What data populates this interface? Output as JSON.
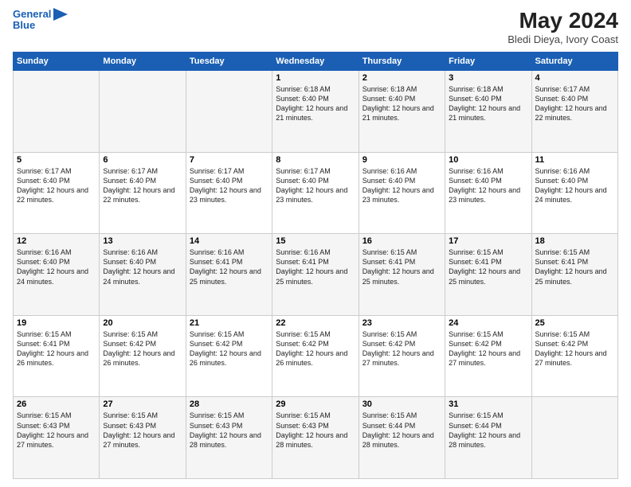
{
  "logo": {
    "line1": "General",
    "line2": "Blue"
  },
  "title": "May 2024",
  "subtitle": "Bledi Dieya, Ivory Coast",
  "days_header": [
    "Sunday",
    "Monday",
    "Tuesday",
    "Wednesday",
    "Thursday",
    "Friday",
    "Saturday"
  ],
  "weeks": [
    [
      {
        "day": "",
        "info": ""
      },
      {
        "day": "",
        "info": ""
      },
      {
        "day": "",
        "info": ""
      },
      {
        "day": "1",
        "info": "Sunrise: 6:18 AM\nSunset: 6:40 PM\nDaylight: 12 hours and 21 minutes."
      },
      {
        "day": "2",
        "info": "Sunrise: 6:18 AM\nSunset: 6:40 PM\nDaylight: 12 hours and 21 minutes."
      },
      {
        "day": "3",
        "info": "Sunrise: 6:18 AM\nSunset: 6:40 PM\nDaylight: 12 hours and 21 minutes."
      },
      {
        "day": "4",
        "info": "Sunrise: 6:17 AM\nSunset: 6:40 PM\nDaylight: 12 hours and 22 minutes."
      }
    ],
    [
      {
        "day": "5",
        "info": "Sunrise: 6:17 AM\nSunset: 6:40 PM\nDaylight: 12 hours and 22 minutes."
      },
      {
        "day": "6",
        "info": "Sunrise: 6:17 AM\nSunset: 6:40 PM\nDaylight: 12 hours and 22 minutes."
      },
      {
        "day": "7",
        "info": "Sunrise: 6:17 AM\nSunset: 6:40 PM\nDaylight: 12 hours and 23 minutes."
      },
      {
        "day": "8",
        "info": "Sunrise: 6:17 AM\nSunset: 6:40 PM\nDaylight: 12 hours and 23 minutes."
      },
      {
        "day": "9",
        "info": "Sunrise: 6:16 AM\nSunset: 6:40 PM\nDaylight: 12 hours and 23 minutes."
      },
      {
        "day": "10",
        "info": "Sunrise: 6:16 AM\nSunset: 6:40 PM\nDaylight: 12 hours and 23 minutes."
      },
      {
        "day": "11",
        "info": "Sunrise: 6:16 AM\nSunset: 6:40 PM\nDaylight: 12 hours and 24 minutes."
      }
    ],
    [
      {
        "day": "12",
        "info": "Sunrise: 6:16 AM\nSunset: 6:40 PM\nDaylight: 12 hours and 24 minutes."
      },
      {
        "day": "13",
        "info": "Sunrise: 6:16 AM\nSunset: 6:40 PM\nDaylight: 12 hours and 24 minutes."
      },
      {
        "day": "14",
        "info": "Sunrise: 6:16 AM\nSunset: 6:41 PM\nDaylight: 12 hours and 25 minutes."
      },
      {
        "day": "15",
        "info": "Sunrise: 6:16 AM\nSunset: 6:41 PM\nDaylight: 12 hours and 25 minutes."
      },
      {
        "day": "16",
        "info": "Sunrise: 6:15 AM\nSunset: 6:41 PM\nDaylight: 12 hours and 25 minutes."
      },
      {
        "day": "17",
        "info": "Sunrise: 6:15 AM\nSunset: 6:41 PM\nDaylight: 12 hours and 25 minutes."
      },
      {
        "day": "18",
        "info": "Sunrise: 6:15 AM\nSunset: 6:41 PM\nDaylight: 12 hours and 25 minutes."
      }
    ],
    [
      {
        "day": "19",
        "info": "Sunrise: 6:15 AM\nSunset: 6:41 PM\nDaylight: 12 hours and 26 minutes."
      },
      {
        "day": "20",
        "info": "Sunrise: 6:15 AM\nSunset: 6:42 PM\nDaylight: 12 hours and 26 minutes."
      },
      {
        "day": "21",
        "info": "Sunrise: 6:15 AM\nSunset: 6:42 PM\nDaylight: 12 hours and 26 minutes."
      },
      {
        "day": "22",
        "info": "Sunrise: 6:15 AM\nSunset: 6:42 PM\nDaylight: 12 hours and 26 minutes."
      },
      {
        "day": "23",
        "info": "Sunrise: 6:15 AM\nSunset: 6:42 PM\nDaylight: 12 hours and 27 minutes."
      },
      {
        "day": "24",
        "info": "Sunrise: 6:15 AM\nSunset: 6:42 PM\nDaylight: 12 hours and 27 minutes."
      },
      {
        "day": "25",
        "info": "Sunrise: 6:15 AM\nSunset: 6:42 PM\nDaylight: 12 hours and 27 minutes."
      }
    ],
    [
      {
        "day": "26",
        "info": "Sunrise: 6:15 AM\nSunset: 6:43 PM\nDaylight: 12 hours and 27 minutes."
      },
      {
        "day": "27",
        "info": "Sunrise: 6:15 AM\nSunset: 6:43 PM\nDaylight: 12 hours and 27 minutes."
      },
      {
        "day": "28",
        "info": "Sunrise: 6:15 AM\nSunset: 6:43 PM\nDaylight: 12 hours and 28 minutes."
      },
      {
        "day": "29",
        "info": "Sunrise: 6:15 AM\nSunset: 6:43 PM\nDaylight: 12 hours and 28 minutes."
      },
      {
        "day": "30",
        "info": "Sunrise: 6:15 AM\nSunset: 6:44 PM\nDaylight: 12 hours and 28 minutes."
      },
      {
        "day": "31",
        "info": "Sunrise: 6:15 AM\nSunset: 6:44 PM\nDaylight: 12 hours and 28 minutes."
      },
      {
        "day": "",
        "info": ""
      }
    ]
  ]
}
